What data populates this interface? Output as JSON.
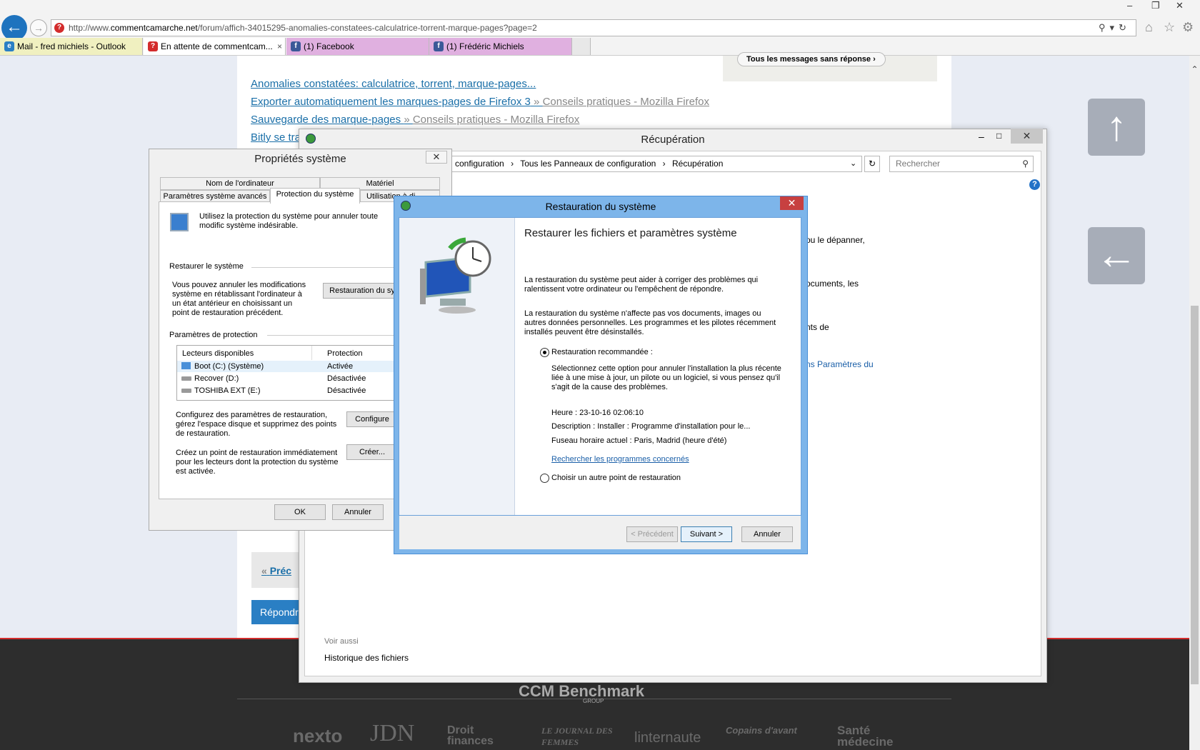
{
  "browser": {
    "url_prefix": "http://www.",
    "url_domain": "commentcamarche.net",
    "url_path": "/forum/affich-34015295-anomalies-constatees-calculatrice-torrent-marque-pages?page=2",
    "tabs": [
      {
        "label": "Mail - fred michiels - Outlook",
        "icon": "outlook-icon",
        "color": "#f0f0c0"
      },
      {
        "label": "En attente de commentcam...",
        "icon": "ccm-icon",
        "color": "#ffffff"
      },
      {
        "label": "(1) Facebook",
        "icon": "facebook-icon",
        "color": "#e0b0e0"
      },
      {
        "label": "(1) Frédéric Michiels",
        "icon": "facebook-icon",
        "color": "#e0b0e0"
      }
    ],
    "close_tab": "×"
  },
  "page": {
    "unanswered_btn": "Tous les messages sans réponse",
    "links": [
      {
        "text": "Anomalies constatées: calculatrice, torrent, marque-pages..."
      },
      {
        "text": "Exporter automatiquement les marques-pages de Firefox 3",
        "sep": " » ",
        "sub": "Conseils pratiques - Mozilla Firefox"
      },
      {
        "text": "Sauvegarde des marque-pages ",
        "sep": "» ",
        "sub": "Conseils pratiques - Mozilla Firefox"
      },
      {
        "text": "Bitly se tra"
      }
    ],
    "prec": "Préc",
    "repondre": "Répondr",
    "footer_brand": "CCM Benchmark",
    "footer_group": "GROUP",
    "brands": [
      "nexto",
      "JDN",
      "Droit finances",
      "LE JOURNAL DES FEMMES",
      "linternaute",
      "Copains d'avant",
      "Santé médecine"
    ]
  },
  "recovery": {
    "title": "Récupération",
    "breadcrumb": [
      " configuration",
      "Tous les Panneaux de configuration",
      "Récupération"
    ],
    "search_placeholder": "Rechercher",
    "fragments": [
      "ou le dépanner,",
      "ocuments, les",
      "nts de",
      "ns Paramètres du"
    ],
    "voir_aussi": "Voir aussi",
    "historique": "Historique des fichiers",
    "help": "?"
  },
  "sysprops": {
    "title": "Propriétés système",
    "tabs_top": [
      "Nom de l'ordinateur",
      "Matériel"
    ],
    "tabs_bottom": [
      "Paramètres système avancés",
      "Protection du système",
      "Utilisation à di"
    ],
    "intro": "Utilisez la protection du système pour annuler toute modific système indésirable.",
    "restore_heading": "Restaurer le système",
    "restore_text": "Vous pouvez annuler les modifications système en rétablissant l'ordinateur à un état antérieur en choisissant un point de restauration précédent.",
    "restore_button": "Restauration du sy",
    "params_heading": "Paramètres de protection",
    "col_drives": "Lecteurs disponibles",
    "col_protection": "Protection",
    "drives": [
      {
        "name": "Boot (C:) (Système)",
        "status": "Activée"
      },
      {
        "name": "Recover (D:)",
        "status": "Désactivée"
      },
      {
        "name": "TOSHIBA EXT (E:)",
        "status": "Désactivée"
      }
    ],
    "configure_text": "Configurez des paramètres de restauration, gérez l'espace disque et supprimez des points de restauration.",
    "configure_button": "Configure",
    "create_text": "Créez un point de restauration immédiatement pour les lecteurs dont la protection du système est activée.",
    "create_button": "Créer...",
    "ok": "OK",
    "cancel": "Annuler"
  },
  "restore": {
    "title": "Restauration du système",
    "heading": "Restaurer les fichiers et paramètres système",
    "p1": "La restauration du système peut aider à corriger des problèmes qui ralentissent votre ordinateur ou l'empêchent de répondre.",
    "p2": "La restauration du système n'affecte pas vos documents, images ou autres données personnelles. Les programmes et les pilotes récemment installés peuvent être désinstallés.",
    "option1": "Restauration recommandée :",
    "option1_desc": "Sélectionnez cette option pour annuler l'installation la plus récente liée à une mise à jour, un pilote ou un logiciel, si vous pensez qu'il s'agit de la cause des problèmes.",
    "time": "Heure : 23-10-16 02:06:10",
    "description": "Description : Installer : Programme d'installation pour le...",
    "timezone": "Fuseau horaire actuel : Paris, Madrid (heure d'été)",
    "link": "Rechercher les programmes concernés",
    "option2": "Choisir un autre point de restauration",
    "btn_prev": "< Précédent",
    "btn_next": "Suivant >",
    "btn_cancel": "Annuler"
  }
}
